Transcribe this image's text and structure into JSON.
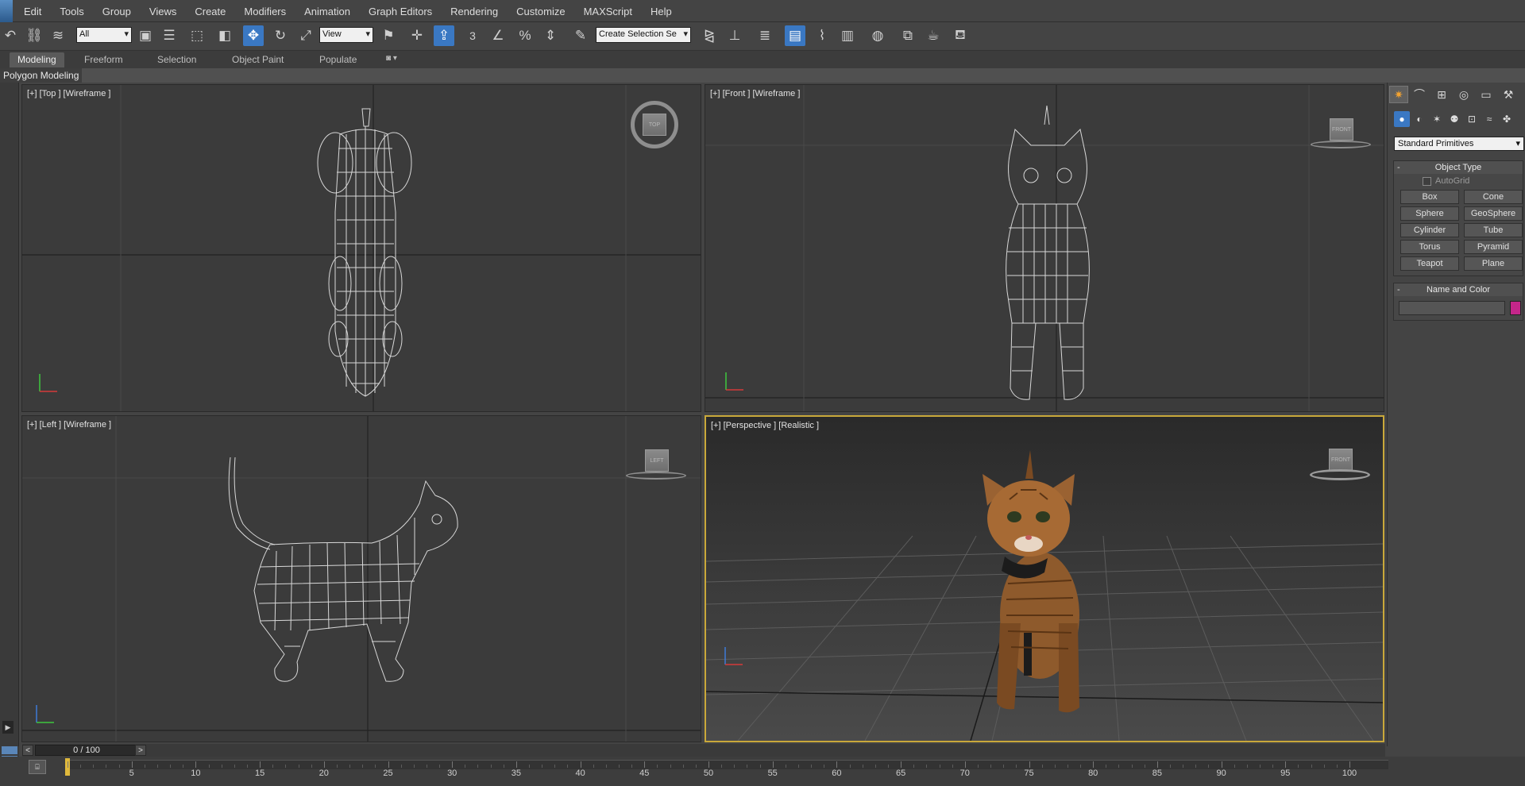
{
  "menu": [
    "Edit",
    "Tools",
    "Group",
    "Views",
    "Create",
    "Modifiers",
    "Animation",
    "Graph Editors",
    "Rendering",
    "Customize",
    "MAXScript",
    "Help"
  ],
  "toolbar": {
    "selection_filter": "All",
    "reference_coord": "View",
    "named_selection": "Create Selection Se",
    "snap_label": "3"
  },
  "ribbon": {
    "tabs": [
      "Modeling",
      "Freeform",
      "Selection",
      "Object Paint",
      "Populate"
    ],
    "active_tab": "Modeling",
    "subpanel": "Polygon Modeling"
  },
  "viewports": {
    "top": {
      "label": "[+] [Top ] [Wireframe ]",
      "cube": "TOP"
    },
    "front": {
      "label": "[+] [Front ] [Wireframe ]",
      "cube": "FRONT"
    },
    "left": {
      "label": "[+] [Left ] [Wireframe ]",
      "cube": "LEFT"
    },
    "perspective": {
      "label": "[+] [Perspective ] [Realistic ]",
      "cube": "FRONT"
    }
  },
  "command_panel": {
    "category": "Standard Primitives",
    "object_type": {
      "title": "Object Type",
      "autogrid": "AutoGrid",
      "buttons": [
        "Box",
        "Cone",
        "Sphere",
        "GeoSphere",
        "Cylinder",
        "Tube",
        "Torus",
        "Pyramid",
        "Teapot",
        "Plane"
      ]
    },
    "name_color": {
      "title": "Name and Color",
      "name_value": "",
      "color": "#c4268a"
    }
  },
  "timeline": {
    "position": "0 / 100",
    "ticks": [
      "5",
      "10",
      "15",
      "20",
      "25",
      "30",
      "35",
      "40",
      "45",
      "50",
      "55",
      "60",
      "65",
      "70",
      "75",
      "80",
      "85",
      "90",
      "95",
      "100"
    ]
  },
  "colors": {
    "accent": "#3a78c3",
    "active_viewport_border": "#c9a83a",
    "frame_marker": "#e0b93c"
  }
}
